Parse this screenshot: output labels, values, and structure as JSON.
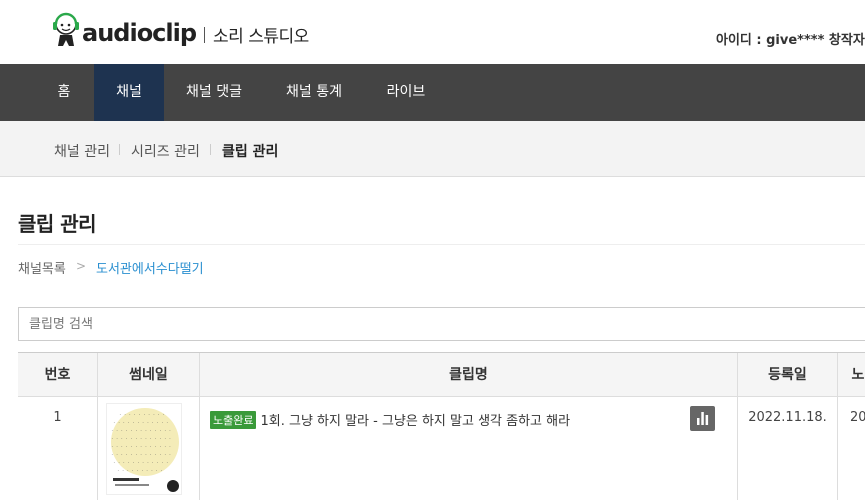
{
  "header": {
    "brand_name": "audioclip",
    "brand_sub": "소리 스튜디오",
    "user_info": "아이디 : give**** 창작자"
  },
  "gnb": {
    "items": [
      {
        "label": "홈",
        "active": false
      },
      {
        "label": "채널",
        "active": true
      },
      {
        "label": "채널 댓글",
        "active": false
      },
      {
        "label": "채널 통계",
        "active": false
      },
      {
        "label": "라이브",
        "active": false
      }
    ]
  },
  "lnb": {
    "items": [
      {
        "label": "채널 관리",
        "active": false
      },
      {
        "label": "시리즈 관리",
        "active": false
      },
      {
        "label": "클립 관리",
        "active": true
      }
    ]
  },
  "content": {
    "title": "클립 관리",
    "breadcrumb_root": "채널목록",
    "breadcrumb_arrow": ">",
    "breadcrumb_channel": "도서관에서수다떨기",
    "search_placeholder": "클립명 검색"
  },
  "table": {
    "headers": [
      "번호",
      "썸네일",
      "클립명",
      "등록일",
      "노"
    ],
    "rows": [
      {
        "number": "1",
        "status_badge": "노출완료",
        "title": "1회. 그냥 하지 말라 - 그냥은 하지 말고 생각 좀하고 해라",
        "date": "2022.11.18.",
        "extra": "20"
      }
    ]
  },
  "colors": {
    "gnb_bg": "#444444",
    "gnb_active": "#1e3350",
    "badge_green": "#3a9a3a",
    "link_blue": "#2a8fd0"
  },
  "icons": {
    "logo": "headphone-mascot-icon",
    "stats": "bar-chart-icon"
  }
}
